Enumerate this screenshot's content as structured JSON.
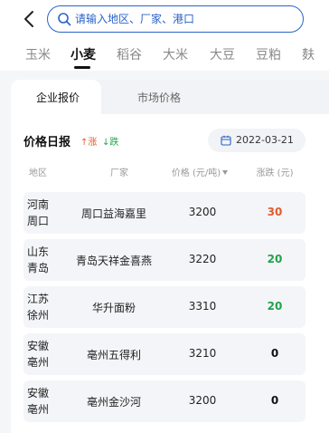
{
  "header": {
    "search": {
      "placeholder": "请输入地区、厂家、港口",
      "value": ""
    }
  },
  "tabs": [
    {
      "label": "玉米",
      "active": false
    },
    {
      "label": "小麦",
      "active": true
    },
    {
      "label": "稻谷",
      "active": false
    },
    {
      "label": "大米",
      "active": false
    },
    {
      "label": "大豆",
      "active": false
    },
    {
      "label": "豆粕",
      "active": false
    },
    {
      "label": "麸",
      "active": false
    }
  ],
  "segments": [
    {
      "label": "企业报价",
      "active": true
    },
    {
      "label": "市场价格",
      "active": false
    }
  ],
  "price_section": {
    "title": "价格日报",
    "legend_up": "↑涨",
    "legend_down": "↓跌",
    "date": "2022-03-21"
  },
  "table": {
    "headers": [
      "地区",
      "厂家",
      "价格 (元/吨)",
      "涨跌 (元)"
    ],
    "rows": [
      {
        "region_line1": "河南",
        "region_line2": "周口",
        "factory": "周口益海嘉里",
        "price": "3200",
        "change": "30",
        "trend": "up"
      },
      {
        "region_line1": "山东",
        "region_line2": "青岛",
        "factory": "青岛天祥金喜燕",
        "price": "3220",
        "change": "20",
        "trend": "down"
      },
      {
        "region_line1": "江苏",
        "region_line2": "徐州",
        "factory": "华升面粉",
        "price": "3310",
        "change": "20",
        "trend": "down"
      },
      {
        "region_line1": "安徽",
        "region_line2": "亳州",
        "factory": "亳州五得利",
        "price": "3210",
        "change": "0",
        "trend": "flat"
      },
      {
        "region_line1": "安徽",
        "region_line2": "亳州",
        "factory": "亳州金沙河",
        "price": "3200",
        "change": "0",
        "trend": "flat"
      }
    ]
  },
  "colors": {
    "accent": "#2a63c8",
    "up": "#e25b2c",
    "down": "#1fa34a",
    "flat": "#111111"
  }
}
